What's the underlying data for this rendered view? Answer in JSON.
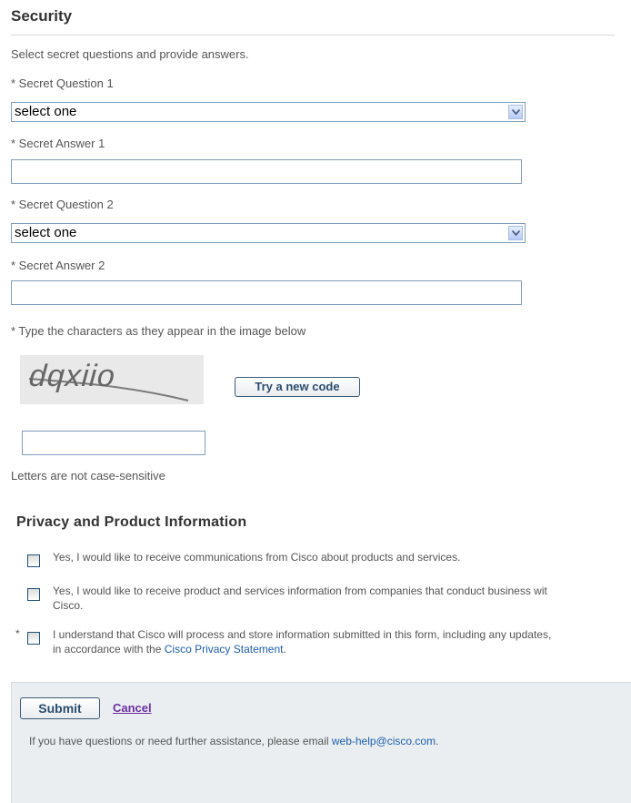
{
  "security": {
    "title": "Security",
    "intro": "Select secret questions and provide answers.",
    "question1_label": "* Secret Question 1",
    "question1_value": "select one",
    "answer1_label": "* Secret Answer 1",
    "answer1_value": "",
    "question2_label": "* Secret Question 2",
    "question2_value": "select one",
    "answer2_label": "* Secret Answer 2",
    "answer2_value": ""
  },
  "captcha": {
    "instruction": "* Type the characters as they appear in the image below",
    "image_text": "dqxiio",
    "try_new_label": "Try a new code",
    "input_value": "",
    "note": "Letters are not case-sensitive"
  },
  "privacy": {
    "title": "Privacy and Product Information",
    "options": [
      {
        "line1": "Yes, I would like to receive communications from Cisco about products and services.",
        "checked": false
      },
      {
        "line1": "Yes, I would like to receive product and services information from companies that conduct business wit",
        "line2": "Cisco.",
        "checked": false
      },
      {
        "required": "*",
        "line1": "I understand that Cisco will process and store information submitted in this form, including any updates,",
        "line2_prefix": "in accordance with the ",
        "line2_link": "Cisco Privacy Statement",
        "line2_suffix": ".",
        "checked": false
      }
    ]
  },
  "footer": {
    "submit_label": "Submit",
    "cancel_label": "Cancel",
    "help_prefix": "If you have questions or need further assistance, please email ",
    "help_email": "web-help@cisco.com",
    "help_suffix": "."
  },
  "icons": {
    "dropdown": "chevron-down-icon"
  },
  "colors": {
    "link": "#1f5eae",
    "visited_link": "#6b2fa4",
    "input_border": "#7f9db9",
    "footer_bg": "#eaeef1"
  }
}
